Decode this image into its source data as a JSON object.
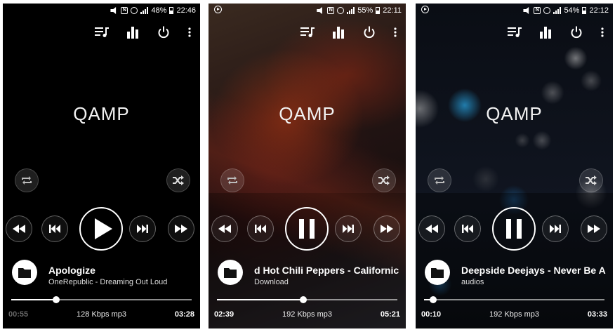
{
  "screens": [
    {
      "statusbar": {
        "battery": "48%",
        "time": "22:46",
        "show_play_indicator": false
      },
      "logo": "QAMP",
      "track": {
        "title": "Apologize",
        "subtitle": "OneRepublic - Dreaming Out Loud"
      },
      "state": "paused",
      "progress": 0.25,
      "elapsed": "00:55",
      "info": "128 Kbps mp3",
      "total": "03:28",
      "background": "black"
    },
    {
      "statusbar": {
        "battery": "55%",
        "time": "22:11",
        "show_play_indicator": true
      },
      "logo": "QAMP",
      "track": {
        "title": "d Hot Chili Peppers - Californic",
        "subtitle": "Download"
      },
      "state": "playing",
      "progress": 0.48,
      "elapsed": "02:39",
      "info": "192 Kbps mp3",
      "total": "05:21",
      "background": "red-abstract"
    },
    {
      "statusbar": {
        "battery": "54%",
        "time": "22:12",
        "show_play_indicator": true
      },
      "logo": "QAMP",
      "track": {
        "title": "Deepside Deejays - Never Be A",
        "subtitle": "audios"
      },
      "state": "playing",
      "progress": 0.05,
      "elapsed": "00:10",
      "info": "192 Kbps mp3",
      "total": "03:33",
      "background": "bokeh-blue"
    }
  ],
  "icons": {
    "queue": "queue-music-icon",
    "equalizer": "equalizer-icon",
    "power": "power-icon",
    "more": "more-vert-icon",
    "repeat": "repeat-icon",
    "shuffle": "shuffle-icon",
    "rewind": "fast-rewind-icon",
    "previous": "skip-previous-icon",
    "play": "play-icon",
    "pause": "pause-icon",
    "next": "skip-next-icon",
    "forward": "fast-forward-icon",
    "folder": "folder-icon"
  },
  "colors": {
    "accent": "#ffffff",
    "background": "#000000"
  }
}
